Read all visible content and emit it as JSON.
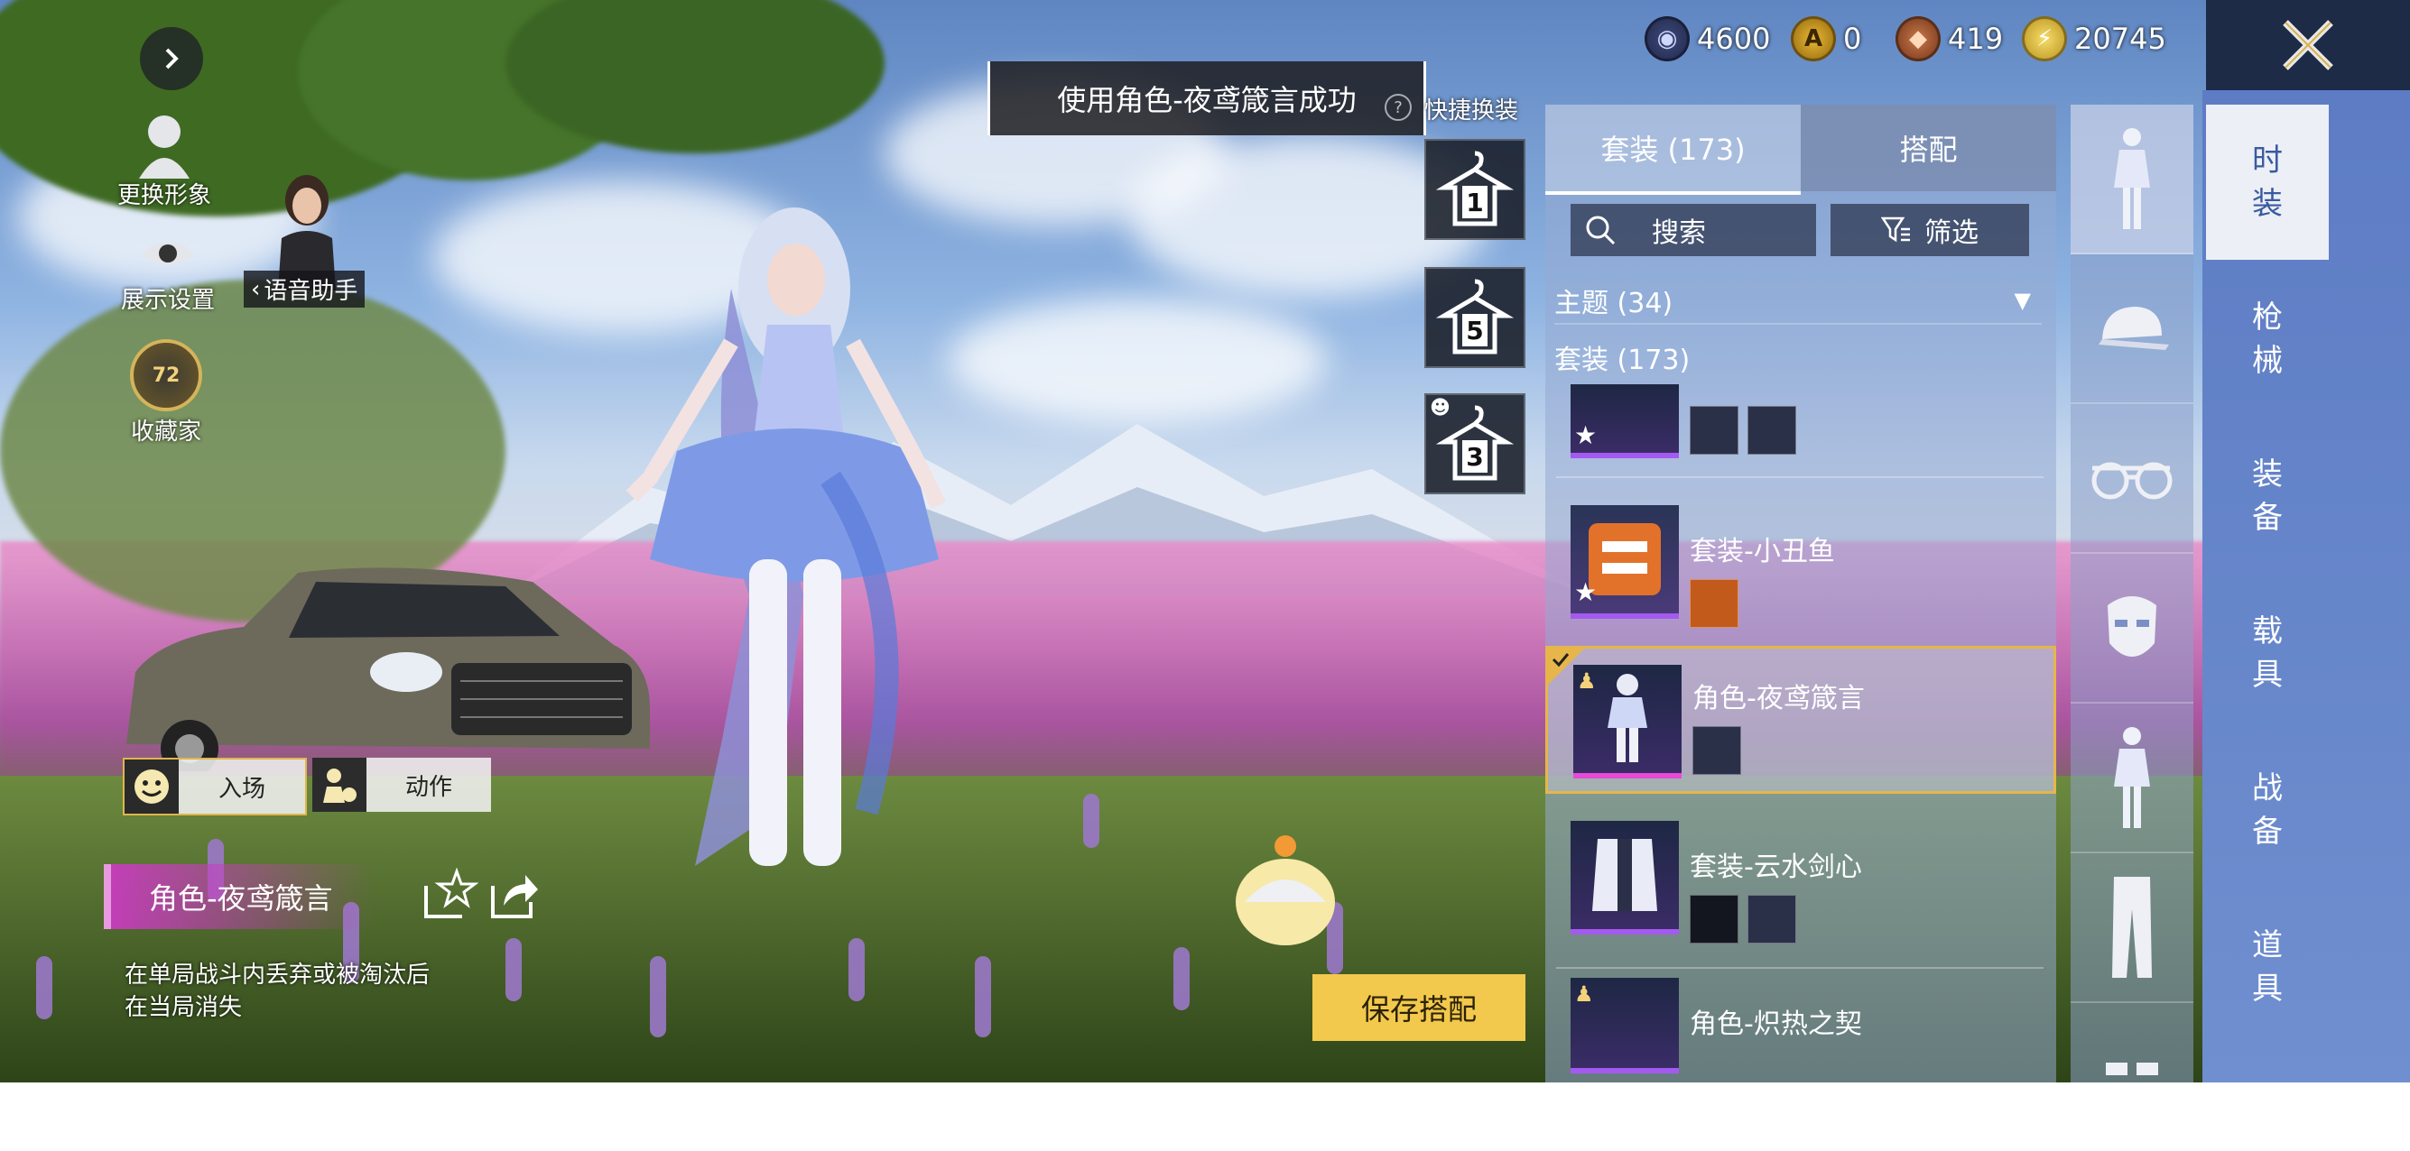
{
  "currencies": [
    {
      "icon": "uc-coin-icon",
      "value": "4600"
    },
    {
      "icon": "ag-coin-icon",
      "value": "0"
    },
    {
      "icon": "bp-coin-icon",
      "value": "419"
    },
    {
      "icon": "lightning-coin-icon",
      "value": "20745"
    }
  ],
  "left_hud": {
    "change_avatar": "更换形象",
    "display_settings": "展示设置",
    "voice_assistant": "语音助手",
    "collector": "收藏家",
    "collector_level": "72"
  },
  "toast": "使用角色-夜鸢箴言成功",
  "quick_change": {
    "title": "快捷换装",
    "help": "?",
    "slots": [
      "1",
      "5",
      "3"
    ]
  },
  "actions": {
    "entrance": "入场",
    "emote": "动作"
  },
  "selected_item": {
    "name": "角色-夜鸢箴言",
    "note_line1": "在单局战斗内丢弃或被淘汰后",
    "note_line2": "在当局消失"
  },
  "save_button": "保存搭配",
  "panel": {
    "tabs": [
      "套装 (173)",
      "搭配"
    ],
    "search": "搜索",
    "filter": "筛选",
    "theme": "主题 (34)",
    "suits_label": "套装 (173)",
    "items": [
      {
        "name": "套装-小丑鱼"
      },
      {
        "name": "角色-夜鸢箴言",
        "selected": true
      },
      {
        "name": "套装-云水剑心"
      },
      {
        "name": "角色-炽热之契"
      }
    ]
  },
  "categories": [
    "outfit-figure-icon",
    "cap-icon",
    "glasses-icon",
    "mask-icon",
    "outfit-figure-icon",
    "pants-icon"
  ],
  "side_tabs": [
    "时装",
    "枪械",
    "装备",
    "载具",
    "战备",
    "道具"
  ]
}
